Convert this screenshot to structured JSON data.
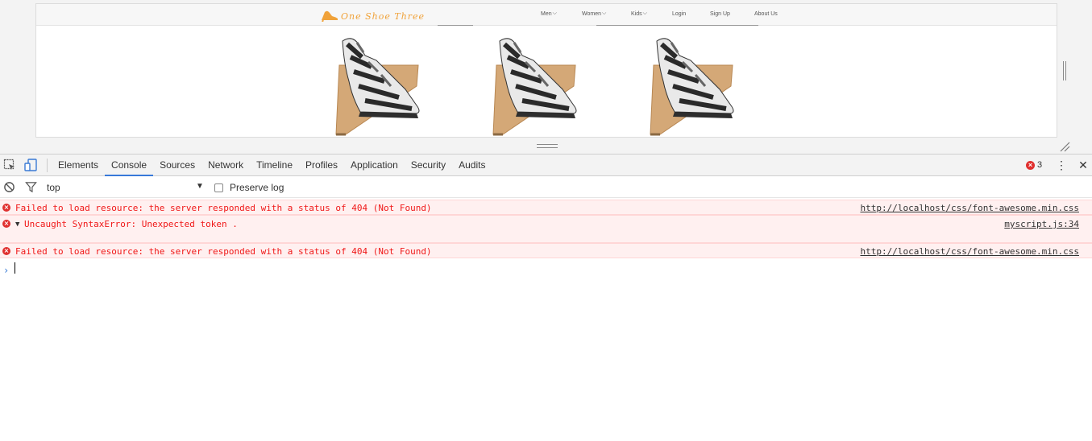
{
  "site": {
    "logo_text": "One Shoe Three",
    "nav": [
      {
        "label": "Men",
        "dropdown": true
      },
      {
        "label": "Women",
        "dropdown": true
      },
      {
        "label": "Kids",
        "dropdown": true
      },
      {
        "label": "Login",
        "dropdown": false
      },
      {
        "label": "Sign Up",
        "dropdown": false
      },
      {
        "label": "About Us",
        "dropdown": false
      }
    ],
    "accent_color": "#f0a23a"
  },
  "devtools": {
    "tabs": [
      "Elements",
      "Console",
      "Sources",
      "Network",
      "Timeline",
      "Profiles",
      "Application",
      "Security",
      "Audits"
    ],
    "active_tab": "Console",
    "error_count": "3",
    "console_toolbar": {
      "context": "top",
      "preserve_log_label": "Preserve log"
    },
    "messages": [
      {
        "text": "Failed to load resource: the server responded with a status of 404 (Not Found)",
        "source": "http://localhost/css/font-awesome.min.css",
        "expandable": false
      },
      {
        "text": "Uncaught SyntaxError: Unexpected token .",
        "source": "myscript.js:34",
        "expandable": true
      },
      {
        "text": "Failed to load resource: the server responded with a status of 404 (Not Found)",
        "source": "http://localhost/css/font-awesome.min.css",
        "expandable": false
      }
    ],
    "prompt_symbol": "›"
  },
  "icons": {
    "inspect": "inspect-element-icon",
    "device": "device-toolbar-icon",
    "clear": "clear-console-icon",
    "filter": "filter-icon",
    "error": "error-icon",
    "more": "kebab-menu-icon",
    "close": "close-icon"
  }
}
